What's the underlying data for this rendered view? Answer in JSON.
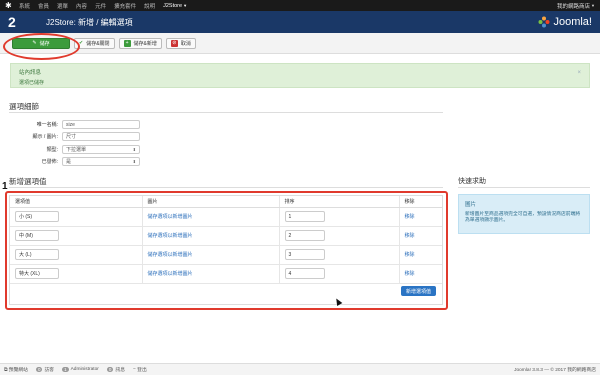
{
  "topbar": {
    "menu": [
      "系統",
      "會員",
      "選單",
      "內容",
      "元件",
      "擴充套件",
      "說明"
    ],
    "active_menu": "J2Store",
    "site_label": "我的網路商店"
  },
  "header": {
    "title": "J2Store: 新增 / 編輯選項",
    "brand": "Joomla!"
  },
  "toolbar": {
    "save": "儲存",
    "save_close": "儲存&關閉",
    "save_new": "儲存&新增",
    "cancel": "取消"
  },
  "message": {
    "title": "站內訊息",
    "body": "選項已儲存",
    "close": "×"
  },
  "options_section": {
    "title": "選項細節",
    "fields": [
      {
        "label": "唯一名稱:",
        "value": "size"
      },
      {
        "label": "顯示 / 圖片:",
        "value": "尺寸"
      },
      {
        "label": "類型:",
        "value": "下拉選單"
      },
      {
        "label": "已發佈:",
        "value": "是"
      }
    ]
  },
  "values_section": {
    "title": "新增選項值",
    "headers": [
      "選項值",
      "圖片",
      "排序",
      "移除"
    ],
    "rows": [
      {
        "value": "小 (S)",
        "image_link": "儲存選項以新增圖片",
        "order": "1",
        "remove": "移除"
      },
      {
        "value": "中 (M)",
        "image_link": "儲存選項以新增圖片",
        "order": "2",
        "remove": "移除"
      },
      {
        "value": "大 (L)",
        "image_link": "儲存選項以新增圖片",
        "order": "3",
        "remove": "移除"
      },
      {
        "value": "特大 (XL)",
        "image_link": "儲存選項以新增圖片",
        "order": "4",
        "remove": "移除"
      }
    ],
    "add_button": "新增選項值"
  },
  "help": {
    "title": "快速求助",
    "box_title": "圖片",
    "box_body": "新增圖片至商品選項完全可自選，預設情況商店前端將為單選項顯示圖片。"
  },
  "annotations": {
    "step1": "1",
    "step2": "2"
  },
  "statusbar": {
    "view_site": "預覽網站",
    "visitors_count": "0",
    "visitors": "訪客",
    "admins_count": "1",
    "admins": "Administrator",
    "messages_count": "0",
    "messages": "訊息",
    "logout": "登出",
    "version": "Joomla! 3.8.3 — © 2017 我的網路商店"
  },
  "colors": {
    "header_bg": "#1a3867",
    "save_green": "#3c9b3c",
    "annotation_red": "#e03a2d",
    "link_blue": "#2a6ebb"
  }
}
